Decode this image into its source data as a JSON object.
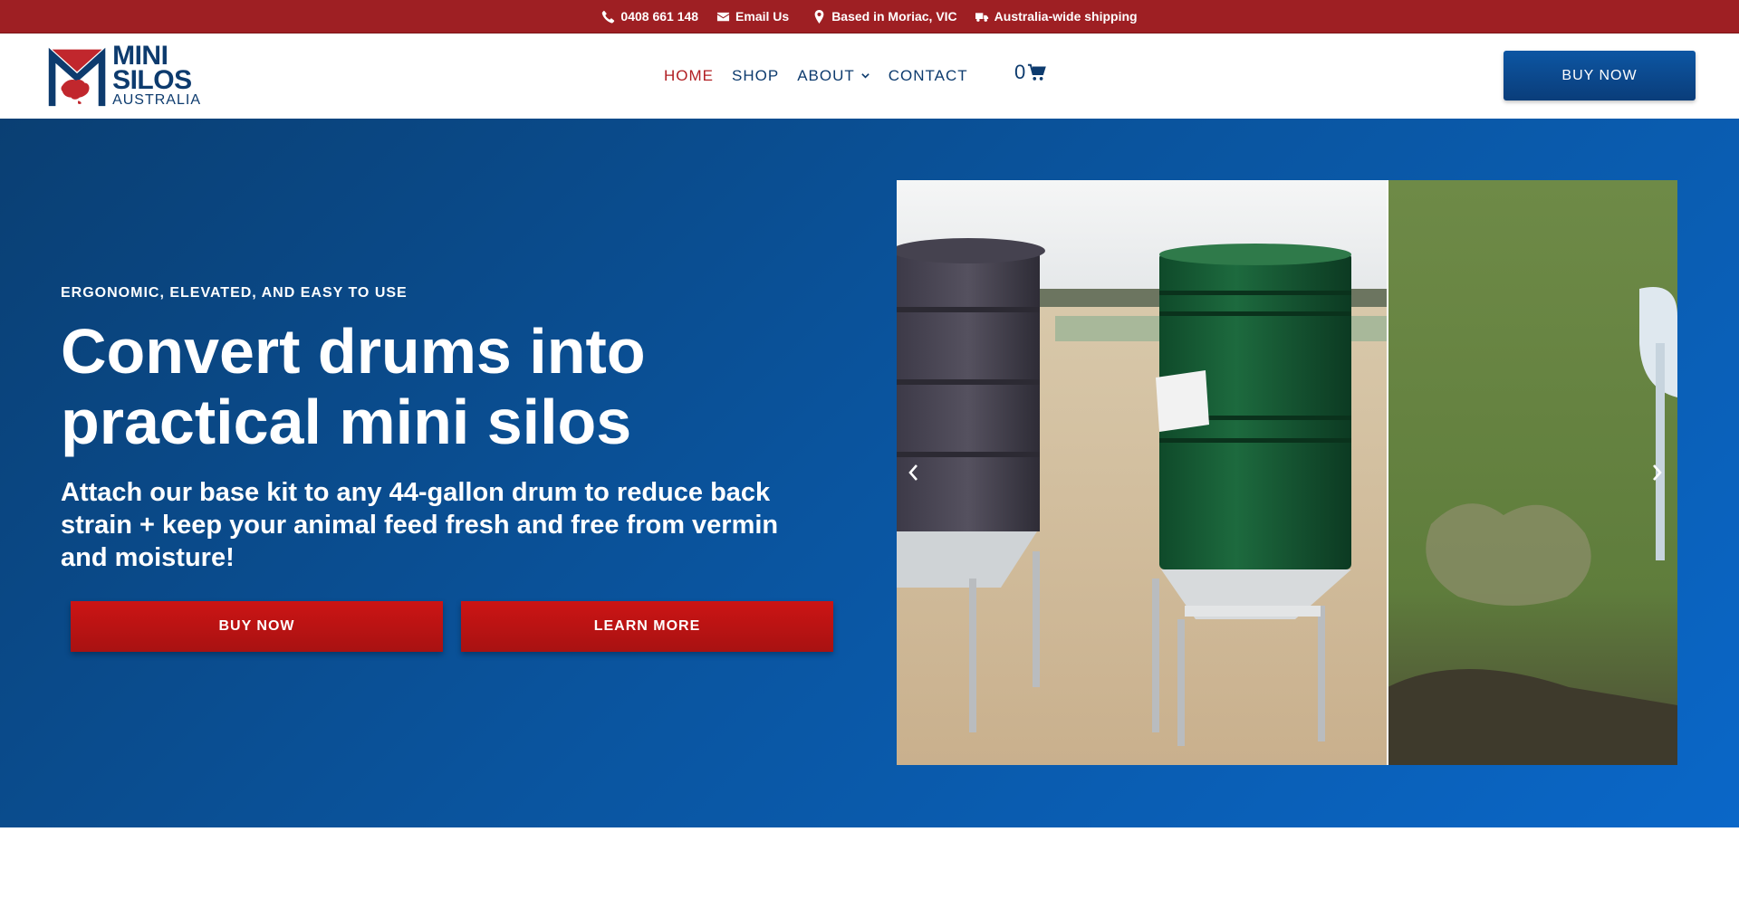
{
  "topbar": {
    "phone": "0408 661 148",
    "email": "Email Us",
    "location": "Based in Moriac, VIC",
    "shipping": "Australia-wide shipping"
  },
  "logo": {
    "line1": "MINI",
    "line2": "SILOS",
    "line3": "AUSTRALIA"
  },
  "nav": {
    "items": [
      {
        "label": "HOME",
        "active": true
      },
      {
        "label": "SHOP"
      },
      {
        "label": "ABOUT"
      },
      {
        "label": "CONTACT"
      }
    ],
    "cart_count": "0",
    "buy_label": "BUY NOW"
  },
  "hero": {
    "kicker": "ERGONOMIC, ELEVATED, AND EASY TO USE",
    "title": "Convert drums into practical mini silos",
    "subtitle": "Attach our base kit to any 44-gallon drum to reduce back strain + keep your animal feed fresh and free from vermin and moisture!",
    "buy_label": "BUY NOW",
    "learn_label": "LEARN MORE"
  },
  "colors": {
    "topbar": "#9e1f23",
    "navy": "#0d3b6e",
    "accent_red": "#b11e22",
    "hero_blue": "#0a55a0",
    "button_red": "#cc1414"
  },
  "icons": [
    "phone-icon",
    "email-icon",
    "location-pin-icon",
    "truck-icon",
    "chevron-down-icon",
    "cart-icon",
    "chevron-left-icon",
    "chevron-right-icon"
  ]
}
